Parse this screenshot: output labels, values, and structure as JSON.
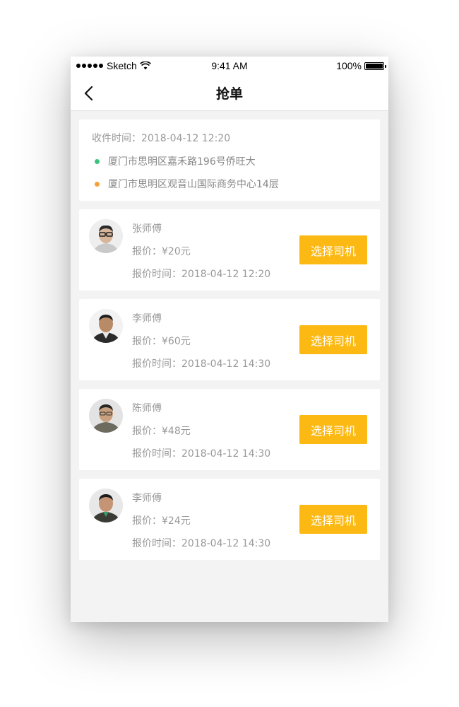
{
  "status_bar": {
    "carrier": "Sketch",
    "time": "9:41 AM",
    "battery": "100%",
    "battery_level": 1.0
  },
  "nav": {
    "title": "抢单",
    "back_icon": "chevron-left-icon"
  },
  "order": {
    "pickup_time": "收件时间：2018-04-12 12:20",
    "from_address": "厦门市思明区嘉禾路196号侨旺大",
    "to_address": "厦门市思明区观音山国际商务中心14层",
    "from_color": "#3cc47c",
    "to_color": "#f5a23c"
  },
  "drivers": [
    {
      "name": "张师傅",
      "price": "报价：¥20元",
      "quote_time": "报价时间：2018-04-12 12:20",
      "button": "选择司机"
    },
    {
      "name": "李师傅",
      "price": "报价：¥60元",
      "quote_time": "报价时间：2018-04-12 14:30",
      "button": "选择司机"
    },
    {
      "name": "陈师傅",
      "price": "报价：¥48元",
      "quote_time": "报价时间：2018-04-12 14:30",
      "button": "选择司机"
    },
    {
      "name": "李师傅",
      "price": "报价：¥24元",
      "quote_time": "报价时间：2018-04-12 14:30",
      "button": "选择司机"
    }
  ],
  "colors": {
    "accent": "#fdb913",
    "background": "#f3f3f3",
    "text_secondary": "#999999"
  }
}
